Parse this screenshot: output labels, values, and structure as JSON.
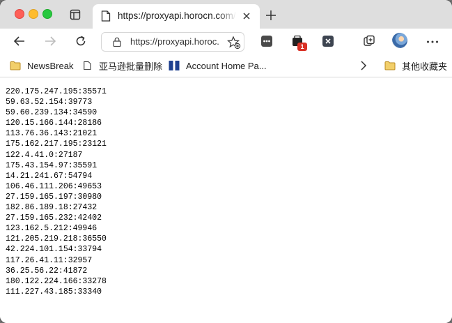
{
  "tab": {
    "title": "https://proxyapi.horocn.com/api/proxies"
  },
  "toolbar": {
    "url": "https://proxyapi.horoc...",
    "notification_badge": "1"
  },
  "bookmarks": {
    "items": [
      {
        "label": "NewsBreak",
        "icon": "folder-icon"
      },
      {
        "label": "亚马逊批量删除",
        "icon": "page-icon"
      },
      {
        "label": "Account Home Pa...",
        "icon": "site-icon"
      }
    ],
    "other_folder": "其他收藏夹"
  },
  "proxies": [
    "220.175.247.195:35571",
    "59.63.52.154:39773",
    "59.60.239.134:34590",
    "120.15.166.144:28186",
    "113.76.36.143:21021",
    "175.162.217.195:23121",
    "122.4.41.0:27187",
    "175.43.154.97:35591",
    "14.21.241.67:54794",
    "106.46.111.206:49653",
    "27.159.165.197:30980",
    "182.86.189.18:27432",
    "27.159.165.232:42402",
    "123.162.5.212:49946",
    "121.205.219.218:36550",
    "42.224.101.154:33794",
    "117.26.41.11:32957",
    "36.25.56.22:41872",
    "180.122.224.166:33278",
    "111.227.43.185:33340"
  ],
  "colors": {
    "close": "#fe5f57",
    "minimize": "#febc2e",
    "maximize": "#28c840",
    "folder": "#e8b84d",
    "badge": "#d93025"
  }
}
